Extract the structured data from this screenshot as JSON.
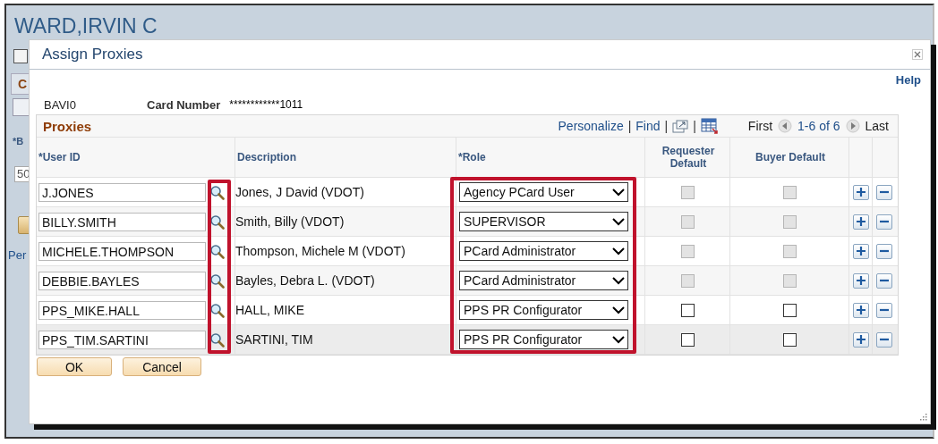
{
  "background": {
    "title": "WARD,IRVIN C",
    "checkbox_checked": false,
    "tab_label": "C",
    "field_label": "*B",
    "field_value": "50",
    "link": "Per"
  },
  "dialog": {
    "title": "Assign Proxies",
    "help_link": "Help",
    "card_id": "BAVI0",
    "card_number_label": "Card Number",
    "card_number": "************1011",
    "grid": {
      "title": "Proxies",
      "toolbar": [
        {
          "kind": "link",
          "text": "Personalize"
        },
        {
          "kind": "separator",
          "text": "|"
        },
        {
          "kind": "link",
          "text": "Find"
        },
        {
          "kind": "separator",
          "text": "|"
        },
        {
          "kind": "popout"
        },
        {
          "kind": "separator",
          "text": "|"
        },
        {
          "kind": "export"
        }
      ],
      "navigation": {
        "first": "First",
        "range": "1-6 of 6",
        "last": "Last"
      },
      "columns": [
        "*User ID",
        "Description",
        "*Role",
        "Requester Default",
        "Buyer Default"
      ],
      "rows": [
        {
          "user_id": "J.JONES",
          "description": "Jones, J David (VDOT)",
          "role": "Agency PCard User",
          "requester_default": {
            "checked": false,
            "disabled": true
          },
          "buyer_default": {
            "checked": false,
            "disabled": true
          }
        },
        {
          "user_id": "BILLY.SMITH",
          "description": "Smith, Billy (VDOT)",
          "role": "SUPERVISOR",
          "requester_default": {
            "checked": false,
            "disabled": true
          },
          "buyer_default": {
            "checked": false,
            "disabled": true
          }
        },
        {
          "user_id": "MICHELE.THOMPSON",
          "description": "Thompson, Michele M (VDOT)",
          "role": "PCard Administrator",
          "requester_default": {
            "checked": false,
            "disabled": true
          },
          "buyer_default": {
            "checked": false,
            "disabled": true
          }
        },
        {
          "user_id": "DEBBIE.BAYLES",
          "description": "Bayles, Debra L. (VDOT)",
          "role": "PCard Administrator",
          "requester_default": {
            "checked": false,
            "disabled": true
          },
          "buyer_default": {
            "checked": false,
            "disabled": true
          }
        },
        {
          "user_id": "PPS_MIKE.HALL",
          "description": "HALL, MIKE",
          "role": "PPS PR Configurator",
          "requester_default": {
            "checked": false,
            "disabled": false
          },
          "buyer_default": {
            "checked": false,
            "disabled": false
          }
        },
        {
          "user_id": "PPS_TIM.SARTINI",
          "description": "SARTINI, TIM",
          "role": "PPS PR Configurator",
          "requester_default": {
            "checked": false,
            "disabled": false
          },
          "buyer_default": {
            "checked": false,
            "disabled": false
          }
        }
      ]
    },
    "buttons": [
      "OK",
      "Cancel"
    ],
    "highlights": {
      "lookup_icons": true,
      "role_column": true
    }
  }
}
